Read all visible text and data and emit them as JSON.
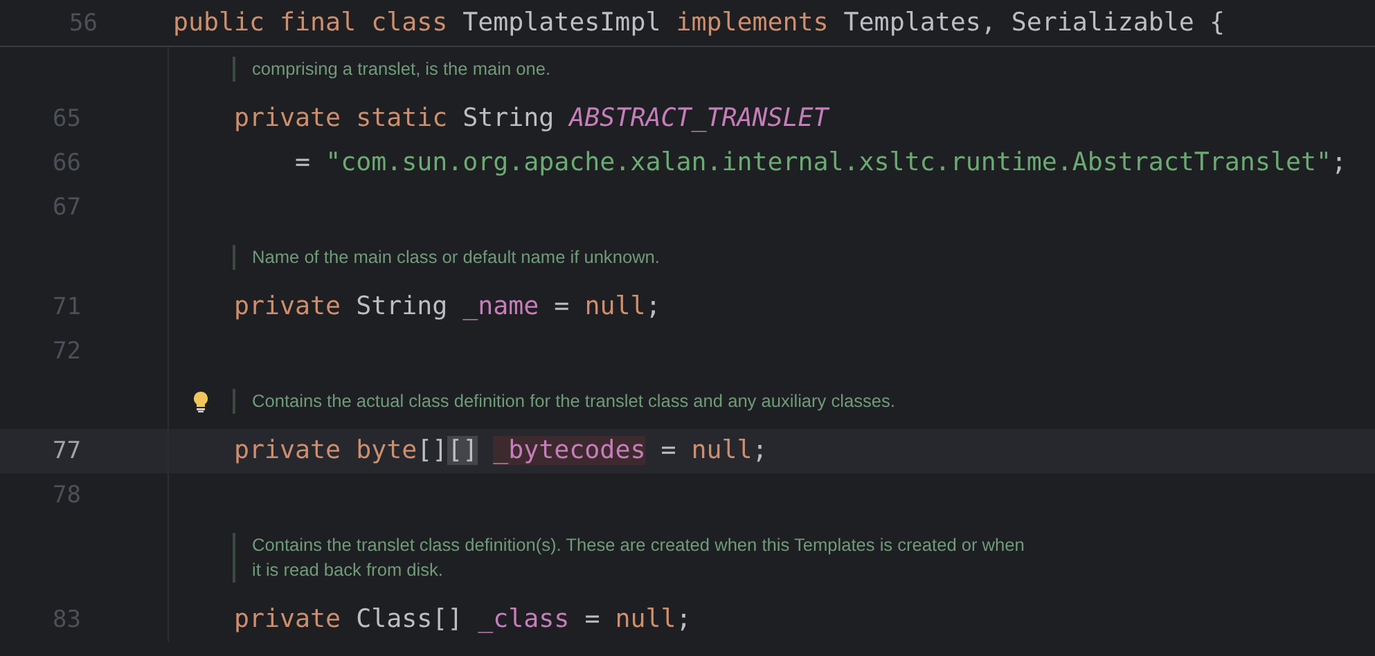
{
  "sticky_header": {
    "number": "56",
    "tokens": [
      {
        "text": "public final class ",
        "kind": "keyword"
      },
      {
        "text": "TemplatesImpl ",
        "kind": "plain"
      },
      {
        "text": "implements ",
        "kind": "keyword"
      },
      {
        "text": "Templates, Serializable {",
        "kind": "plain"
      }
    ]
  },
  "lines": [
    {
      "kind": "doc",
      "intention_bulb": false,
      "lines": [
        "comprising a translet, is the main one."
      ]
    },
    {
      "kind": "code",
      "number": "65",
      "selected": false,
      "tokens": [
        {
          "text": "    private static ",
          "kind": "keyword"
        },
        {
          "text": "String ",
          "kind": "plain"
        },
        {
          "text": "ABSTRACT_TRANSLET",
          "kind": "constant"
        }
      ]
    },
    {
      "kind": "code",
      "number": "66",
      "selected": false,
      "tokens": [
        {
          "text": "        = ",
          "kind": "plain"
        },
        {
          "text": "\"com.sun.org.apache.xalan.internal.xsltc.runtime.AbstractTranslet\"",
          "kind": "string"
        },
        {
          "text": ";",
          "kind": "plain"
        }
      ]
    },
    {
      "kind": "code",
      "number": "67",
      "selected": false
    },
    {
      "kind": "doc",
      "intention_bulb": false,
      "lines": [
        "Name of the main class or default name if unknown."
      ]
    },
    {
      "kind": "code",
      "number": "71",
      "selected": false,
      "tokens": [
        {
          "text": "    private ",
          "kind": "keyword"
        },
        {
          "text": "String ",
          "kind": "plain"
        },
        {
          "text": "_name",
          "kind": "field"
        },
        {
          "text": " = ",
          "kind": "plain"
        },
        {
          "text": "null",
          "kind": "keyword"
        },
        {
          "text": ";",
          "kind": "plain"
        }
      ]
    },
    {
      "kind": "code",
      "number": "72",
      "selected": false
    },
    {
      "kind": "doc",
      "intention_bulb": true,
      "lines": [
        "Contains the actual class definition for the translet class and any auxiliary classes."
      ]
    },
    {
      "kind": "code",
      "number": "77",
      "selected": true,
      "tokens": [
        {
          "text": "    private byte",
          "kind": "keyword"
        },
        {
          "text": "[]",
          "kind": "plain"
        },
        {
          "text": "[]",
          "kind": "bracket_match"
        },
        {
          "text": "_bytecodes",
          "kind": "field_usage"
        },
        {
          "text": " = ",
          "kind": "plain"
        },
        {
          "text": "null",
          "kind": "keyword"
        },
        {
          "text": ";",
          "kind": "plain"
        }
      ]
    },
    {
      "kind": "code",
      "number": "78",
      "selected": false
    },
    {
      "kind": "doc",
      "intention_bulb": false,
      "lines": [
        "Contains the translet class definition(s). These are created when this Templates is created or when",
        "it is read back from disk."
      ]
    },
    {
      "kind": "code",
      "number": "83",
      "selected": false,
      "tokens": [
        {
          "text": "    private ",
          "kind": "keyword"
        },
        {
          "text": "Class[] ",
          "kind": "plain"
        },
        {
          "text": "_class",
          "kind": "field"
        },
        {
          "text": " = ",
          "kind": "plain"
        },
        {
          "text": "null",
          "kind": "keyword"
        },
        {
          "text": ";",
          "kind": "plain"
        }
      ]
    }
  ]
}
